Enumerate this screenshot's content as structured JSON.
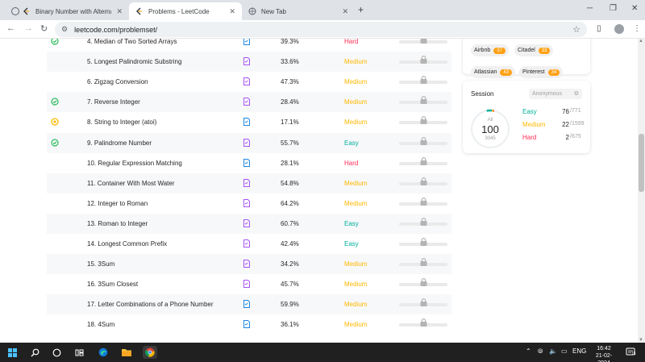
{
  "browser": {
    "tabs": [
      {
        "title": "Binary Number with Alternating",
        "close": "✕"
      },
      {
        "title": "Problems - LeetCode",
        "close": "✕"
      },
      {
        "title": "New Tab",
        "close": "✕"
      }
    ],
    "new_tab_glyph": "+",
    "url": "leetcode.com/problemset/",
    "window_controls": {
      "minimize": "─",
      "maximize": "❐",
      "close": "✕"
    }
  },
  "problems": [
    {
      "status": "solved",
      "title": "4. Median of Two Sorted Arrays",
      "acceptance": "39.3%",
      "difficulty": "Hard",
      "sol_color": "#1e88e5"
    },
    {
      "status": "none",
      "title": "5. Longest Palindromic Substring",
      "acceptance": "33.6%",
      "difficulty": "Medium",
      "sol_color": "#a855f7"
    },
    {
      "status": "none",
      "title": "6. Zigzag Conversion",
      "acceptance": "47.3%",
      "difficulty": "Medium",
      "sol_color": "#a855f7"
    },
    {
      "status": "solved",
      "title": "7. Reverse Integer",
      "acceptance": "28.4%",
      "difficulty": "Medium",
      "sol_color": "#a855f7"
    },
    {
      "status": "attempted",
      "title": "8. String to Integer (atoi)",
      "acceptance": "17.1%",
      "difficulty": "Medium",
      "sol_color": "#1e88e5"
    },
    {
      "status": "solved",
      "title": "9. Palindrome Number",
      "acceptance": "55.7%",
      "difficulty": "Easy",
      "sol_color": "#a855f7"
    },
    {
      "status": "none",
      "title": "10. Regular Expression Matching",
      "acceptance": "28.1%",
      "difficulty": "Hard",
      "sol_color": "#1e88e5"
    },
    {
      "status": "none",
      "title": "11. Container With Most Water",
      "acceptance": "54.8%",
      "difficulty": "Medium",
      "sol_color": "#a855f7"
    },
    {
      "status": "none",
      "title": "12. Integer to Roman",
      "acceptance": "64.2%",
      "difficulty": "Medium",
      "sol_color": "#a855f7"
    },
    {
      "status": "none",
      "title": "13. Roman to Integer",
      "acceptance": "60.7%",
      "difficulty": "Easy",
      "sol_color": "#a855f7"
    },
    {
      "status": "none",
      "title": "14. Longest Common Prefix",
      "acceptance": "42.4%",
      "difficulty": "Easy",
      "sol_color": "#a855f7"
    },
    {
      "status": "none",
      "title": "15. 3Sum",
      "acceptance": "34.2%",
      "difficulty": "Medium",
      "sol_color": "#a855f7"
    },
    {
      "status": "none",
      "title": "16. 3Sum Closest",
      "acceptance": "45.7%",
      "difficulty": "Medium",
      "sol_color": "#a855f7"
    },
    {
      "status": "none",
      "title": "17. Letter Combinations of a Phone Number",
      "acceptance": "59.9%",
      "difficulty": "Medium",
      "sol_color": "#1e88e5"
    },
    {
      "status": "none",
      "title": "18. 4Sum",
      "acceptance": "36.1%",
      "difficulty": "Medium",
      "sol_color": "#1e88e5"
    }
  ],
  "companies": [
    {
      "name": "Airbnb",
      "count": "37"
    },
    {
      "name": "Citadel",
      "count": "33"
    },
    {
      "name": "Atlassian",
      "count": "43"
    },
    {
      "name": "Pinterest",
      "count": "34"
    }
  ],
  "session": {
    "title": "Session",
    "selector": "Anonymous",
    "ring_label": "All",
    "solved": "100",
    "total": "3045",
    "stats": [
      {
        "label": "Easy",
        "solved": "76",
        "total": "/771",
        "color": "#00af9b"
      },
      {
        "label": "Medium",
        "solved": "22",
        "total": "/1599",
        "color": "#ffb800"
      },
      {
        "label": "Hard",
        "solved": "2",
        "total": "/675",
        "color": "#ff2d55"
      }
    ],
    "fractions": {
      "easy": 0.76,
      "medium": 0.22,
      "hard": 0.02
    }
  },
  "taskbar": {
    "language": "ENG",
    "time": "16:42",
    "date": "21-02-2024",
    "notifications": "15"
  },
  "colors": {
    "easy": "#00af9b",
    "medium": "#ffb800",
    "hard": "#ff2d55",
    "brand_orange": "#ffa116"
  }
}
